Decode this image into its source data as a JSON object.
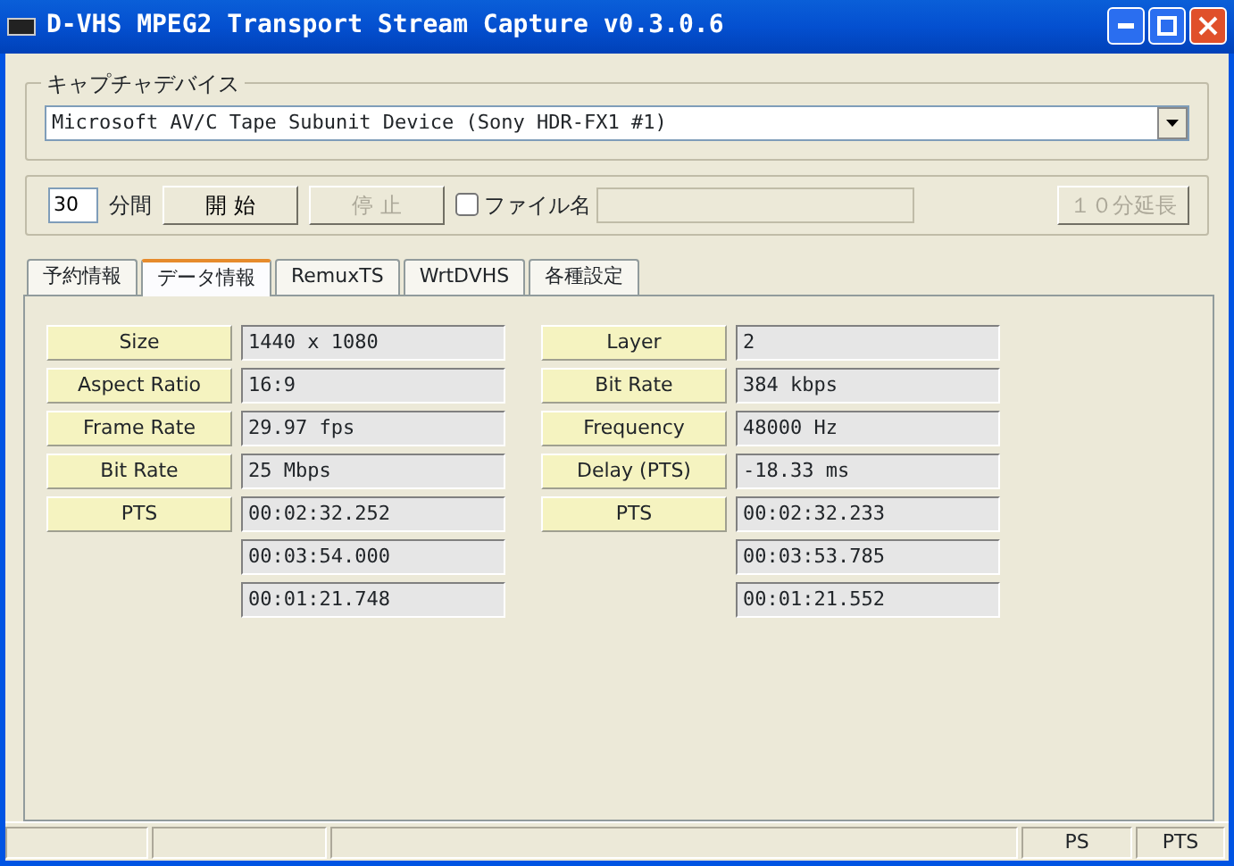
{
  "window": {
    "title": "D-VHS MPEG2 Transport Stream Capture v0.3.0.6"
  },
  "capture_device": {
    "label": "キャプチャデバイス",
    "value": "Microsoft AV/C Tape Subunit Device (Sony HDR-FX1 #1)"
  },
  "controls": {
    "minutes": "30",
    "minutes_unit": "分間",
    "start_button": {
      "label": "開 始",
      "disabled": false
    },
    "stop_button": {
      "label": "停 止",
      "disabled": true
    },
    "filename_checkbox": {
      "label": "ファイル名",
      "checked": false
    },
    "filename_field": {
      "disabled": true
    },
    "extend_button": {
      "label": "１０分延長",
      "disabled": true
    }
  },
  "tabs": [
    {
      "label": "予約情報",
      "selected": false
    },
    {
      "label": "データ情報",
      "selected": true
    },
    {
      "label": "RemuxTS",
      "selected": false
    },
    {
      "label": "WrtDVHS",
      "selected": false
    },
    {
      "label": "各種設定",
      "selected": false
    }
  ],
  "video": [
    {
      "label": "Size",
      "value": "1440 x 1080"
    },
    {
      "label": "Aspect Ratio",
      "value": "16:9"
    },
    {
      "label": "Frame Rate",
      "value": "29.97 fps"
    },
    {
      "label": "Bit Rate",
      "value": "25 Mbps"
    },
    {
      "label": "PTS",
      "value": "00:02:32.252"
    },
    {
      "value": "00:03:54.000"
    },
    {
      "value": "00:01:21.748"
    }
  ],
  "audio": [
    {
      "label": "Layer",
      "value": "2"
    },
    {
      "label": "Bit Rate",
      "value": "384 kbps"
    },
    {
      "label": "Frequency",
      "value": "48000 Hz"
    },
    {
      "label": "Delay (PTS)",
      "value": "-18.33 ms"
    },
    {
      "label": "PTS",
      "value": "00:02:32.233"
    },
    {
      "value": "00:03:53.785"
    },
    {
      "value": "00:01:21.552"
    }
  ],
  "status_bar": [
    "PS",
    "PTS"
  ]
}
